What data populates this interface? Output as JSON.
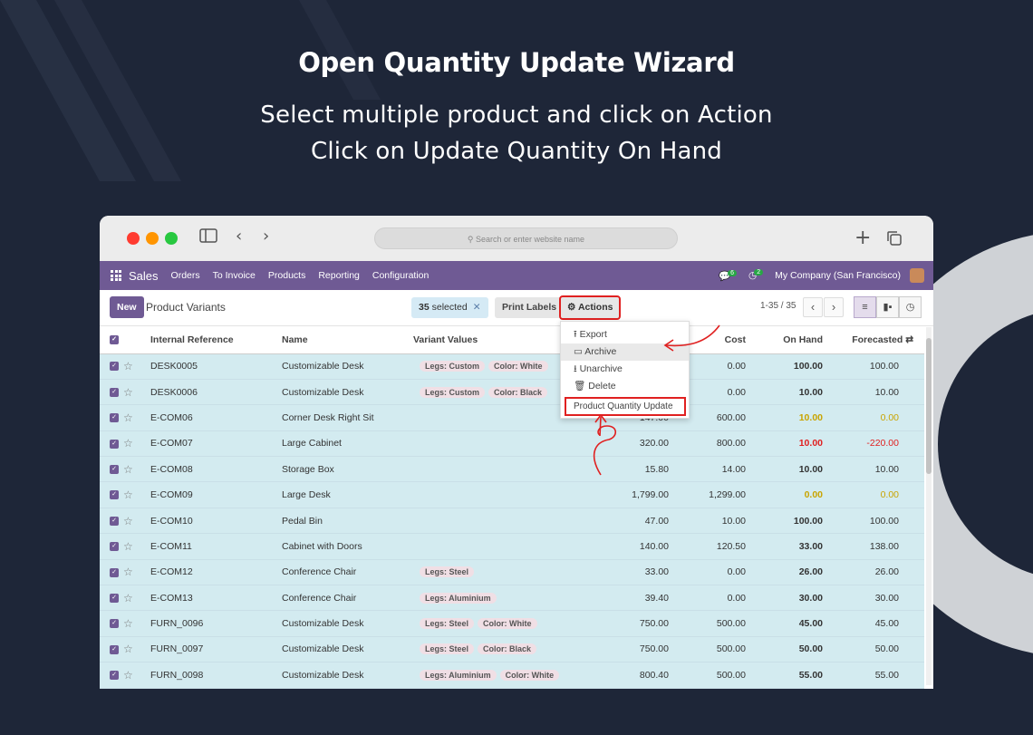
{
  "banner": {
    "title": "Open Quantity Update Wizard",
    "line1": "Select multiple product and click on Action",
    "line2": "Click on Update Quantity On Hand"
  },
  "browser": {
    "url_placeholder": "Search or enter website name",
    "dots": [
      "#ff3b30",
      "#ff9500",
      "#28c840"
    ]
  },
  "navbar": {
    "app_name": "Sales",
    "menus": [
      "Orders",
      "To Invoice",
      "Products",
      "Reporting",
      "Configuration"
    ],
    "chat_count": "6",
    "activity_count": "2",
    "company": "My Company (San Francisco)",
    "color": "#6f5a94"
  },
  "control_panel": {
    "new_label": "New",
    "title": "Product Variants",
    "selected_count": "35",
    "selected_label": "selected",
    "print_labels": "Print Labels",
    "actions_label": "Actions",
    "pager": "1-35 / 35"
  },
  "actions_menu": {
    "items": [
      "Export",
      "Archive",
      "Unarchive",
      "Delete"
    ],
    "highlighted": "Product Quantity Update"
  },
  "table": {
    "headers": [
      "Internal Reference",
      "Name",
      "Variant Values",
      "",
      "Cost",
      "On Hand",
      "Forecasted"
    ],
    "rows": [
      {
        "ref": "DESK0005",
        "name": "Customizable Desk",
        "tags": [
          "Legs: Custom",
          "Color: White"
        ],
        "price": "",
        "cost": "0.00",
        "onhand": "100.00",
        "forecast": "100.00",
        "state": ""
      },
      {
        "ref": "DESK0006",
        "name": "Customizable Desk",
        "tags": [
          "Legs: Custom",
          "Color: Black"
        ],
        "price": "",
        "cost": "0.00",
        "onhand": "10.00",
        "forecast": "10.00",
        "state": ""
      },
      {
        "ref": "E-COM06",
        "name": "Corner Desk Right Sit",
        "tags": [],
        "price": "147.00",
        "cost": "600.00",
        "onhand": "10.00",
        "forecast": "0.00",
        "state": "orange"
      },
      {
        "ref": "E-COM07",
        "name": "Large Cabinet",
        "tags": [],
        "price": "320.00",
        "cost": "800.00",
        "onhand": "10.00",
        "forecast": "-220.00",
        "state": "red"
      },
      {
        "ref": "E-COM08",
        "name": "Storage Box",
        "tags": [],
        "price": "15.80",
        "cost": "14.00",
        "onhand": "10.00",
        "forecast": "10.00",
        "state": ""
      },
      {
        "ref": "E-COM09",
        "name": "Large Desk",
        "tags": [],
        "price": "1,799.00",
        "cost": "1,299.00",
        "onhand": "0.00",
        "forecast": "0.00",
        "state": "orange"
      },
      {
        "ref": "E-COM10",
        "name": "Pedal Bin",
        "tags": [],
        "price": "47.00",
        "cost": "10.00",
        "onhand": "100.00",
        "forecast": "100.00",
        "state": ""
      },
      {
        "ref": "E-COM11",
        "name": "Cabinet with Doors",
        "tags": [],
        "price": "140.00",
        "cost": "120.50",
        "onhand": "33.00",
        "forecast": "138.00",
        "state": ""
      },
      {
        "ref": "E-COM12",
        "name": "Conference Chair",
        "tags": [
          "Legs: Steel"
        ],
        "price": "33.00",
        "cost": "0.00",
        "onhand": "26.00",
        "forecast": "26.00",
        "state": ""
      },
      {
        "ref": "E-COM13",
        "name": "Conference Chair",
        "tags": [
          "Legs: Aluminium"
        ],
        "price": "39.40",
        "cost": "0.00",
        "onhand": "30.00",
        "forecast": "30.00",
        "state": ""
      },
      {
        "ref": "FURN_0096",
        "name": "Customizable Desk",
        "tags": [
          "Legs: Steel",
          "Color: White"
        ],
        "price": "750.00",
        "cost": "500.00",
        "onhand": "45.00",
        "forecast": "45.00",
        "state": ""
      },
      {
        "ref": "FURN_0097",
        "name": "Customizable Desk",
        "tags": [
          "Legs: Steel",
          "Color: Black"
        ],
        "price": "750.00",
        "cost": "500.00",
        "onhand": "50.00",
        "forecast": "50.00",
        "state": ""
      },
      {
        "ref": "FURN_0098",
        "name": "Customizable Desk",
        "tags": [
          "Legs: Aluminium",
          "Color: White"
        ],
        "price": "800.40",
        "cost": "500.00",
        "onhand": "55.00",
        "forecast": "55.00",
        "state": ""
      }
    ]
  }
}
